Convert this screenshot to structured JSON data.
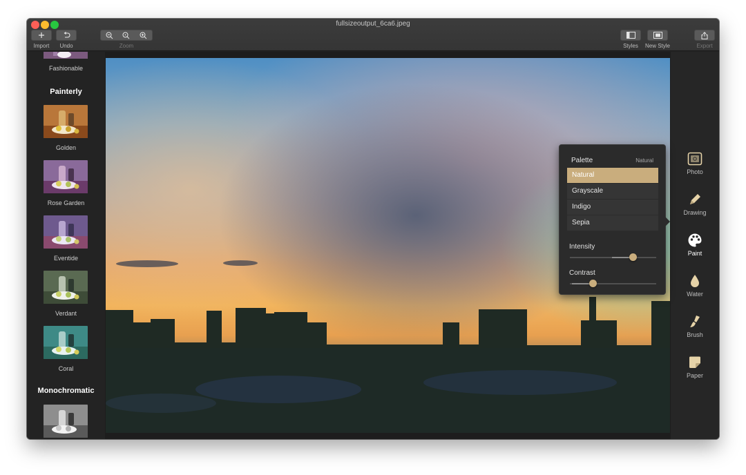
{
  "window": {
    "title": "fullsizeoutput_6ca6.jpeg"
  },
  "toolbar": {
    "import_label": "Import",
    "undo_label": "Undo",
    "zoom_label": "Zoom",
    "styles_label": "Styles",
    "new_style_label": "New Style",
    "export_label": "Export"
  },
  "sidebar": {
    "top_item_label": "Fashionable",
    "section_painterly": "Painterly",
    "styles": [
      {
        "label": "Golden"
      },
      {
        "label": "Rose Garden"
      },
      {
        "label": "Eventide"
      },
      {
        "label": "Verdant"
      },
      {
        "label": "Coral"
      }
    ],
    "section_monochromatic": "Monochromatic"
  },
  "tools": [
    {
      "label": "Photo",
      "icon": "photo-icon"
    },
    {
      "label": "Drawing",
      "icon": "pencil-icon"
    },
    {
      "label": "Paint",
      "icon": "palette-icon",
      "active": true
    },
    {
      "label": "Water",
      "icon": "water-drop-icon"
    },
    {
      "label": "Brush",
      "icon": "brush-icon"
    },
    {
      "label": "Paper",
      "icon": "paper-icon"
    }
  ],
  "popover": {
    "title": "Palette",
    "selected_value": "Natural",
    "options": [
      "Natural",
      "Grayscale",
      "Indigo",
      "Sepia"
    ],
    "intensity_label": "Intensity",
    "intensity_value": 0.73,
    "contrast_label": "Contrast",
    "contrast_value": 0.26
  },
  "colors": {
    "accent": "#c9ad7d",
    "background": "#222222"
  }
}
